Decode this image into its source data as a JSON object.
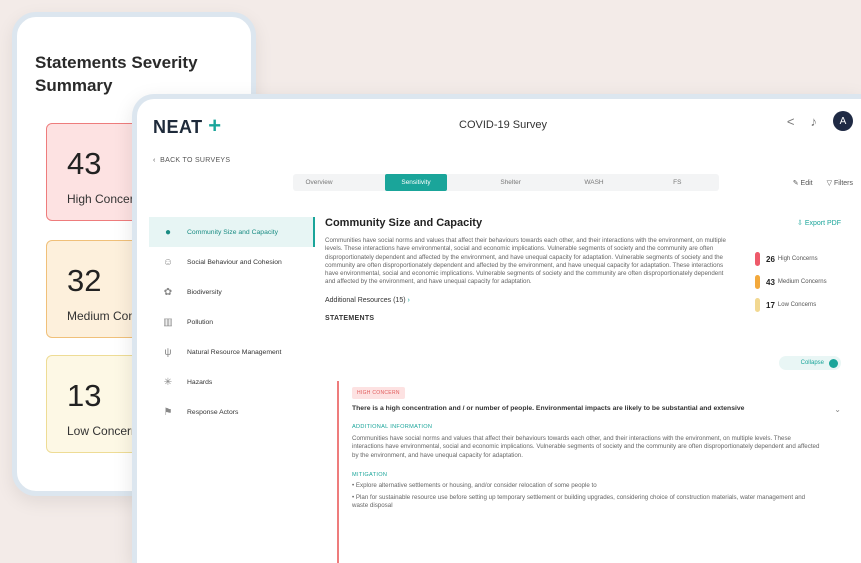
{
  "summary": {
    "title": "Statements Severity Summary",
    "items": [
      {
        "count": "43",
        "label": "High Concerns"
      },
      {
        "count": "32",
        "label": "Medium Concerns"
      },
      {
        "count": "13",
        "label": "Low Concerns"
      }
    ]
  },
  "app": {
    "logo": "NEAT",
    "logo_plus": "+",
    "survey_title": "COVID-19 Survey",
    "avatar": "A",
    "back": "BACK TO SURVEYS",
    "tabs": [
      "Overview",
      "Sensitivity",
      "Shelter",
      "WASH",
      "FS"
    ],
    "edit": "Edit",
    "filters": "Filters"
  },
  "sidebar": {
    "items": [
      {
        "label": "Community Size and Capacity",
        "icon": "people-icon"
      },
      {
        "label": "Social Behaviour and Cohesion",
        "icon": "smile-icon"
      },
      {
        "label": "Biodiversity",
        "icon": "flower-icon"
      },
      {
        "label": "Pollution",
        "icon": "factory-icon"
      },
      {
        "label": "Natural Resource Management",
        "icon": "plant-icon"
      },
      {
        "label": "Hazards",
        "icon": "hazard-icon"
      },
      {
        "label": "Response Actors",
        "icon": "flag-icon"
      }
    ]
  },
  "content": {
    "title": "Community Size and Capacity",
    "export": "Export PDF",
    "description": "Communities have social norms and values that affect their behaviours towards each other, and their interactions with the environment, on multiple levels. These interactions have environmental, social and economic implications. Vulnerable segments of society and the community are often disproportionately dependent and affected by the environment, and have unequal capacity for adaptation. Vulnerable segments of society and the community are often disproportionately dependent and affected by the environment, and have unequal capacity for adaptation. These interactions have environmental, social and economic implications. Vulnerable segments of society and the community are often disproportionately dependent and affected by the environment, and have unequal capacity for adaptation.",
    "concerns": [
      {
        "count": "26",
        "label": "High Concerns",
        "color": "#ee5a6a"
      },
      {
        "count": "43",
        "label": "Medium Concerns",
        "color": "#f3a93c"
      },
      {
        "count": "17",
        "label": "Low Concerns",
        "color": "#f2d891"
      }
    ],
    "additional_resources": "Additional Resources (15)",
    "statements_label": "STATEMENTS",
    "collapse": "Collapse",
    "statement": {
      "badge": "HIGH CONCERN",
      "heading": "There is a high concentration and / or number of people. Environmental impacts are likely to be substantial and extensive",
      "info_label": "ADDITIONAL INFORMATION",
      "info_text": "Communities have social norms and values that affect their behaviours towards each other, and their interactions with the environment, on multiple levels. These interactions have environmental, social and economic implications. Vulnerable segments of society and the community are often disproportionately dependent and affected by the environment, and have unequal capacity for adaptation.",
      "mitigation_label": "MITIGATION",
      "mitigation": [
        "Explore alternative settlements or housing, and/or consider relocation of some people to",
        "Plan for sustainable resource use before setting up temporary settlement or building upgrades, considering choice of construction materials, water management and waste disposal"
      ]
    }
  }
}
